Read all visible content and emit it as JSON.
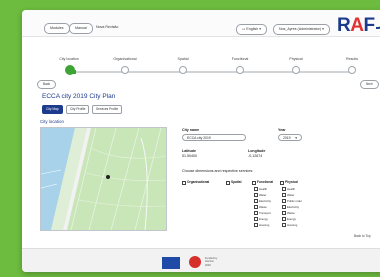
{
  "topbar": {
    "btn1": "Modules",
    "btn2": "Manual",
    "title": "Nova Revisão",
    "lang": "English",
    "user": "Nos_Ayres (Administrator)",
    "logo_r": "R",
    "logo_a": "A",
    "logo_f": "F"
  },
  "steps": [
    "City location",
    "Organisational",
    "Spatial",
    "Functional",
    "Physical",
    "Results"
  ],
  "nav": {
    "back": "Back",
    "next": "Next"
  },
  "page": {
    "title": "ECCA city 2019 City Plan",
    "tabs": [
      "City Map",
      "City Profile",
      "Services Profile"
    ]
  },
  "location": {
    "section": "City location",
    "city_name_label": "City name",
    "city_name_value": "ECCA city 2019",
    "year_label": "Year",
    "year_value": "2019",
    "lat_label": "Latitude",
    "lat_value": "51.50400",
    "lon_label": "Longitude",
    "lon_value": "-0.12674",
    "services_heading": "Choose dimensions and respective services:"
  },
  "dimensions": [
    {
      "label": "Organisational",
      "options": []
    },
    {
      "label": "Spatial",
      "options": []
    },
    {
      "label": "Functional",
      "options": [
        "Health",
        "Water",
        "Electricity",
        "Waste",
        "Transport",
        "Energy",
        "Housing"
      ]
    },
    {
      "label": "Physical",
      "options": [
        "Health",
        "Water",
        "Public order",
        "Electricity",
        "Waste",
        "Energy",
        "Housing"
      ]
    }
  ],
  "back_to_top": "Back to Top",
  "footer": {
    "line1": "Funded by",
    "line2": "Horizon",
    "line3": "2020"
  },
  "colors": {
    "accent": "#1d3b8e",
    "progress": "#3da535",
    "background": "#6dbb3f"
  }
}
